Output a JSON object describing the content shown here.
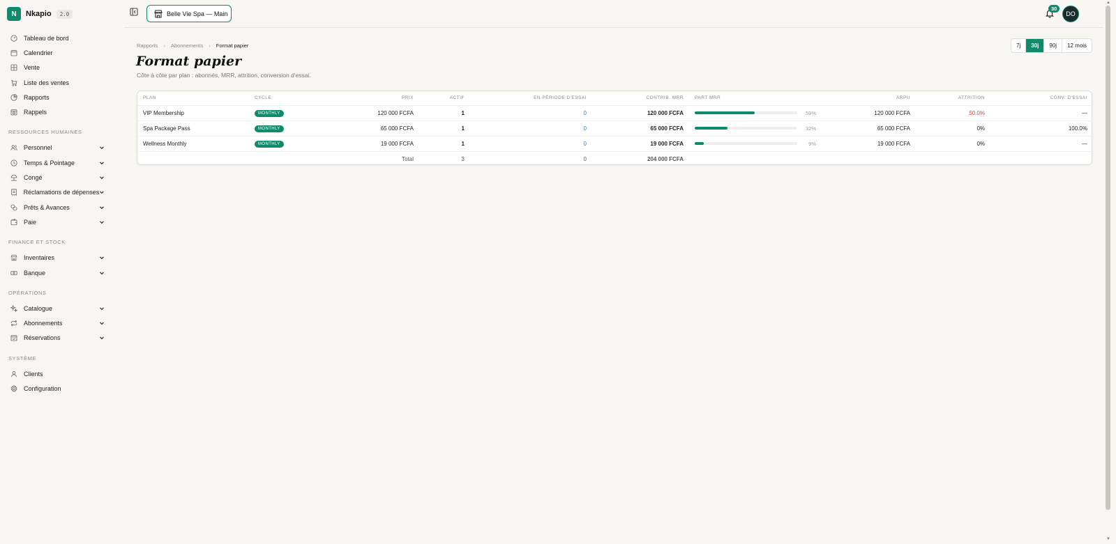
{
  "brand": {
    "logo": "N",
    "name": "Nkapio",
    "version": "2.0"
  },
  "sidebar": {
    "top": [
      {
        "label": "Tableau de bord",
        "icon": "dashboard-icon"
      },
      {
        "label": "Calendrier",
        "icon": "calendar-icon"
      },
      {
        "label": "Vente",
        "icon": "grid-icon"
      },
      {
        "label": "Liste des ventes",
        "icon": "cart-icon"
      },
      {
        "label": "Rapports",
        "icon": "pie-chart-icon"
      },
      {
        "label": "Rappels",
        "icon": "calendar-clock-icon"
      }
    ],
    "sections": [
      {
        "title": "RESSOURCES HUMAINES",
        "items": [
          {
            "label": "Personnel",
            "icon": "users-icon"
          },
          {
            "label": "Temps & Pointage",
            "icon": "clock-icon"
          },
          {
            "label": "Congé",
            "icon": "beach-icon"
          },
          {
            "label": "Réclamations de dépenses",
            "icon": "receipt-icon"
          },
          {
            "label": "Prêts & Avances",
            "icon": "coins-icon"
          },
          {
            "label": "Paie",
            "icon": "wallet-icon"
          }
        ]
      },
      {
        "title": "FINANCE ET STOCK",
        "items": [
          {
            "label": "Inventaires",
            "icon": "store-icon"
          },
          {
            "label": "Banque",
            "icon": "banknote-icon"
          }
        ]
      },
      {
        "title": "OPÉRATIONS",
        "items": [
          {
            "label": "Catalogue",
            "icon": "sparkles-icon"
          },
          {
            "label": "Abonnements",
            "icon": "repeat-icon"
          },
          {
            "label": "Réservations",
            "icon": "calendar-check-icon"
          }
        ]
      },
      {
        "title": "SYSTÈME",
        "items": [
          {
            "label": "Clients",
            "icon": "user-icon"
          },
          {
            "label": "Configuration",
            "icon": "gear-icon"
          }
        ]
      }
    ]
  },
  "topbar": {
    "workspace": "Belle Vie Spa — Main",
    "notifications": "30",
    "avatar": "DO"
  },
  "breadcrumb": [
    "Rapports",
    "Abonnements",
    "Format papier"
  ],
  "page": {
    "title": "Format papier",
    "subtitle": "Côte à côte par plan : abonnés, MRR, attrition, conversion d'essai."
  },
  "ranges": [
    {
      "label": "7j",
      "active": false
    },
    {
      "label": "30j",
      "active": true
    },
    {
      "label": "90j",
      "active": false
    },
    {
      "label": "12 mois",
      "active": false
    }
  ],
  "table": {
    "headers": [
      "PLAN",
      "CYCLE",
      "PRIX",
      "ACTIF",
      "EN PÉRIODE D'ESSAI",
      "CONTRIB. MRR",
      "PART MRR",
      "ARPU",
      "ATTRITION",
      "CONV. D'ESSAI"
    ],
    "rows": [
      {
        "plan": "VIP Membership",
        "cycle": "MONTHLY",
        "prix": "120 000 FCFA",
        "actif": "1",
        "essai": "0",
        "mrr": "120 000 FCFA",
        "part": 59,
        "part_label": "59%",
        "arpu": "120 000 FCFA",
        "attrition": "50.0%",
        "attrition_alert": true,
        "conv": "—"
      },
      {
        "plan": "Spa Package Pass",
        "cycle": "MONTHLY",
        "prix": "65 000 FCFA",
        "actif": "1",
        "essai": "0",
        "mrr": "65 000 FCFA",
        "part": 32,
        "part_label": "32%",
        "arpu": "65 000 FCFA",
        "attrition": "0%",
        "attrition_alert": false,
        "conv": "100.0%"
      },
      {
        "plan": "Wellness Monthly",
        "cycle": "MONTHLY",
        "prix": "19 000 FCFA",
        "actif": "1",
        "essai": "0",
        "mrr": "19 000 FCFA",
        "part": 9,
        "part_label": "9%",
        "arpu": "19 000 FCFA",
        "attrition": "0%",
        "attrition_alert": false,
        "conv": "—"
      }
    ],
    "total": {
      "label": "Total",
      "actif": "3",
      "essai": "0",
      "mrr": "204 000 FCFA"
    }
  },
  "colors": {
    "accent": "#0f8a6b",
    "link": "#2f7fc4",
    "danger": "#d4483f"
  }
}
